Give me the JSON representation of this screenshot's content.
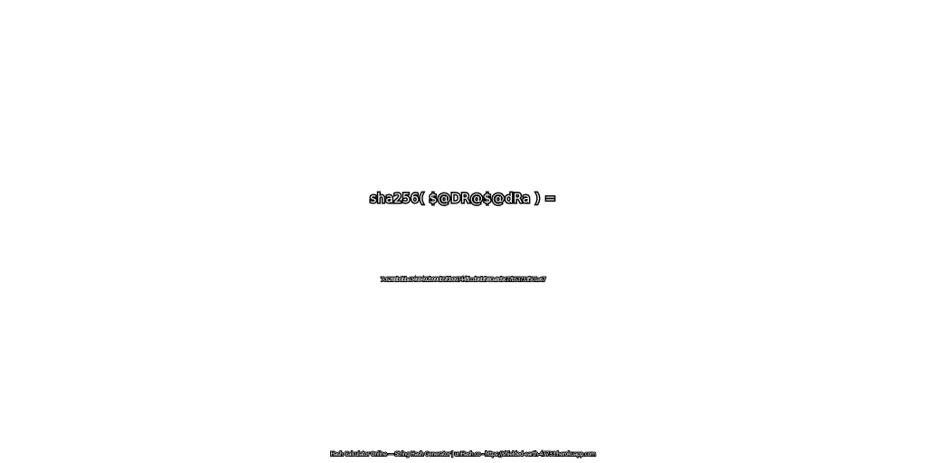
{
  "expression": "sha256( $@DR@$@dRa ) =",
  "hash": "7c6288b9bbe3468492b990b5f0b99744ffccd96bf980a8d9c77b53733f501e67",
  "footer": "Hash Calculator Online — String Hash Generator | unHash.co - https://shielded-earth-47733.herokuapp.com",
  "colors": {
    "background": "#ffffff",
    "text_fill": "#ffffff",
    "text_outline": "#000000"
  }
}
